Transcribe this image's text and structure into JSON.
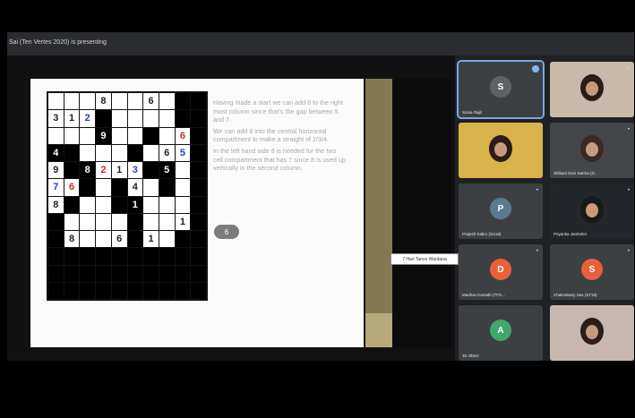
{
  "meeting": {
    "presenting_label": "Sai (Ten Vertes 2020) is presenting",
    "colors": {
      "accent": "#8ab4f8",
      "bg": "#202124"
    }
  },
  "slide": {
    "grid_rows": [
      [
        {
          "t": "",
          "b": false
        },
        {
          "t": "",
          "b": false
        },
        {
          "t": "",
          "b": false
        },
        {
          "t": "8",
          "b": false
        },
        {
          "t": "",
          "b": false
        },
        {
          "t": "",
          "b": false
        },
        {
          "t": "6",
          "b": false
        },
        {
          "t": "",
          "b": false
        },
        {
          "t": "",
          "b": true
        },
        {
          "t": "",
          "b": true
        }
      ],
      [
        {
          "t": "3",
          "b": false
        },
        {
          "t": "1",
          "b": false
        },
        {
          "t": "2",
          "b": false,
          "c": "blue"
        },
        {
          "t": "",
          "b": true
        },
        {
          "t": "",
          "b": false
        },
        {
          "t": "",
          "b": false
        },
        {
          "t": "",
          "b": false
        },
        {
          "t": "",
          "b": false
        },
        {
          "t": "",
          "b": true
        },
        {
          "t": "",
          "b": true
        }
      ],
      [
        {
          "t": "",
          "b": false
        },
        {
          "t": "",
          "b": false
        },
        {
          "t": "",
          "b": false
        },
        {
          "t": "9",
          "b": true
        },
        {
          "t": "",
          "b": false
        },
        {
          "t": "",
          "b": false
        },
        {
          "t": "",
          "b": true
        },
        {
          "t": "",
          "b": false
        },
        {
          "t": "6",
          "b": false,
          "c": "red"
        },
        {
          "t": "",
          "b": true
        }
      ],
      [
        {
          "t": "4",
          "b": true
        },
        {
          "t": "",
          "b": true
        },
        {
          "t": "",
          "b": false
        },
        {
          "t": "",
          "b": false
        },
        {
          "t": "",
          "b": false
        },
        {
          "t": "",
          "b": true
        },
        {
          "t": "",
          "b": false
        },
        {
          "t": "6",
          "b": false
        },
        {
          "t": "5",
          "b": false,
          "c": "blue"
        },
        {
          "t": "",
          "b": true
        }
      ],
      [
        {
          "t": "9",
          "b": false
        },
        {
          "t": "",
          "b": true
        },
        {
          "t": "8",
          "b": true
        },
        {
          "t": "2",
          "b": false,
          "c": "red"
        },
        {
          "t": "1",
          "b": false
        },
        {
          "t": "3",
          "b": false,
          "c": "blue"
        },
        {
          "t": "",
          "b": true
        },
        {
          "t": "5",
          "b": true
        },
        {
          "t": "",
          "b": false
        },
        {
          "t": "",
          "b": true
        }
      ],
      [
        {
          "t": "7",
          "b": false,
          "c": "blue"
        },
        {
          "t": "6",
          "b": false,
          "c": "red"
        },
        {
          "t": "",
          "b": true
        },
        {
          "t": "",
          "b": false
        },
        {
          "t": "",
          "b": true
        },
        {
          "t": "4",
          "b": false
        },
        {
          "t": "",
          "b": false
        },
        {
          "t": "",
          "b": true
        },
        {
          "t": "",
          "b": false
        },
        {
          "t": "",
          "b": true
        }
      ],
      [
        {
          "t": "8",
          "b": false
        },
        {
          "t": "",
          "b": true
        },
        {
          "t": "",
          "b": false
        },
        {
          "t": "",
          "b": false
        },
        {
          "t": "",
          "b": true
        },
        {
          "t": "1",
          "b": true
        },
        {
          "t": "",
          "b": false
        },
        {
          "t": "",
          "b": false
        },
        {
          "t": "",
          "b": false
        },
        {
          "t": "",
          "b": true
        }
      ],
      [
        {
          "t": "",
          "b": true
        },
        {
          "t": "",
          "b": false
        },
        {
          "t": "",
          "b": false
        },
        {
          "t": "",
          "b": false
        },
        {
          "t": "",
          "b": false
        },
        {
          "t": "",
          "b": true
        },
        {
          "t": "",
          "b": false
        },
        {
          "t": "",
          "b": false
        },
        {
          "t": "1",
          "b": false
        },
        {
          "t": "",
          "b": true
        }
      ],
      [
        {
          "t": "",
          "b": true
        },
        {
          "t": "8",
          "b": false
        },
        {
          "t": "",
          "b": false
        },
        {
          "t": "",
          "b": false
        },
        {
          "t": "6",
          "b": false
        },
        {
          "t": "",
          "b": true
        },
        {
          "t": "1",
          "b": false
        },
        {
          "t": "",
          "b": false
        },
        {
          "t": "",
          "b": true
        },
        {
          "t": "",
          "b": true
        }
      ],
      [
        {
          "t": "",
          "b": true
        },
        {
          "t": "",
          "b": true
        },
        {
          "t": "",
          "b": true
        },
        {
          "t": "",
          "b": true
        },
        {
          "t": "",
          "b": true
        },
        {
          "t": "",
          "b": true
        },
        {
          "t": "",
          "b": true
        },
        {
          "t": "",
          "b": true
        },
        {
          "t": "",
          "b": true
        },
        {
          "t": "",
          "b": true
        }
      ],
      [
        {
          "t": "",
          "b": true
        },
        {
          "t": "",
          "b": true
        },
        {
          "t": "",
          "b": true
        },
        {
          "t": "",
          "b": true
        },
        {
          "t": "",
          "b": true
        },
        {
          "t": "",
          "b": true
        },
        {
          "t": "",
          "b": true
        },
        {
          "t": "",
          "b": true
        },
        {
          "t": "",
          "b": true
        },
        {
          "t": "",
          "b": true
        }
      ],
      [
        {
          "t": "",
          "b": true
        },
        {
          "t": "",
          "b": true
        },
        {
          "t": "",
          "b": true
        },
        {
          "t": "",
          "b": true
        },
        {
          "t": "",
          "b": true
        },
        {
          "t": "",
          "b": true
        },
        {
          "t": "",
          "b": true
        },
        {
          "t": "",
          "b": true
        },
        {
          "t": "",
          "b": true
        },
        {
          "t": "",
          "b": true
        }
      ]
    ],
    "notes": [
      "Having made a start we can add 8 to the right most column since that's the gap between 5 and 7.",
      "We can add 8 into the central horizontal compartment to make a straight of 2/3/4.",
      "In the left hand side 8 is needed for the two cell compartment that has 7 since 8 is used up vertically in the second column."
    ],
    "cursor_tag": "6"
  },
  "tooltip": "7 Hari Tanvo Wardana",
  "participants": [
    {
      "name": "Sonia Rajit",
      "type": "avatar",
      "initial": "S",
      "color": "#5f6368",
      "active": true
    },
    {
      "name": "",
      "type": "photo",
      "mic": "•"
    },
    {
      "name": "",
      "type": "photo",
      "mic": ""
    },
    {
      "name": "Shibani Dosi Sarma (G...",
      "type": "photo",
      "mic": "•"
    },
    {
      "name": "Prajesh Kakru (Gu18)",
      "type": "avatar",
      "initial": "P",
      "color": "#5b7b8c",
      "mic": "•"
    },
    {
      "name": "Priyanka Jambekri",
      "type": "photo",
      "mic": "•"
    },
    {
      "name": "Madhav Kamath (TFG...",
      "type": "avatar",
      "initial": "D",
      "color": "#e8613a",
      "mic": "•"
    },
    {
      "name": "Chakrabarty Sas (ST19)",
      "type": "avatar",
      "initial": "S",
      "color": "#e8613a",
      "mic": "•"
    },
    {
      "name": "35 others",
      "type": "avatar",
      "initial": "A",
      "color": "#3fa86a",
      "mic": ""
    },
    {
      "name": "",
      "type": "photo",
      "mic": ""
    }
  ]
}
